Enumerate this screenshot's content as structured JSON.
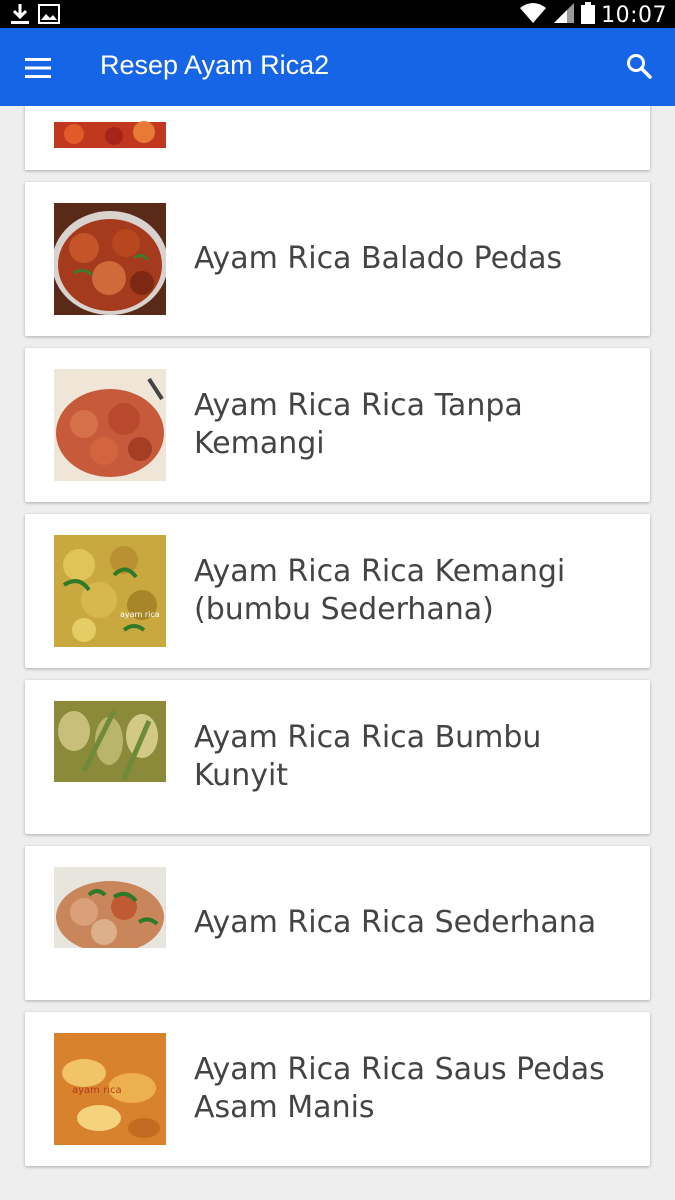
{
  "status_bar": {
    "time": "10:07",
    "left_icons": [
      "download-icon",
      "image-icon"
    ],
    "right_icons": [
      "wifi-icon",
      "signal-icon",
      "battery-icon"
    ]
  },
  "app_bar": {
    "title": "Resep Ayam Rica2",
    "menu_icon": "menu-icon",
    "search_icon": "search-icon",
    "color": "#1565e6"
  },
  "recipes": [
    {
      "title": "Ayam Rica Balado Pedas"
    },
    {
      "title": "Ayam Rica Rica Tanpa Kemangi"
    },
    {
      "title": "Ayam Rica Rica Kemangi (bumbu Sederhana)"
    },
    {
      "title": "Ayam Rica Rica Bumbu Kunyit"
    },
    {
      "title": "Ayam Rica Rica Sederhana"
    },
    {
      "title": "Ayam Rica Rica Saus Pedas Asam Manis"
    }
  ]
}
